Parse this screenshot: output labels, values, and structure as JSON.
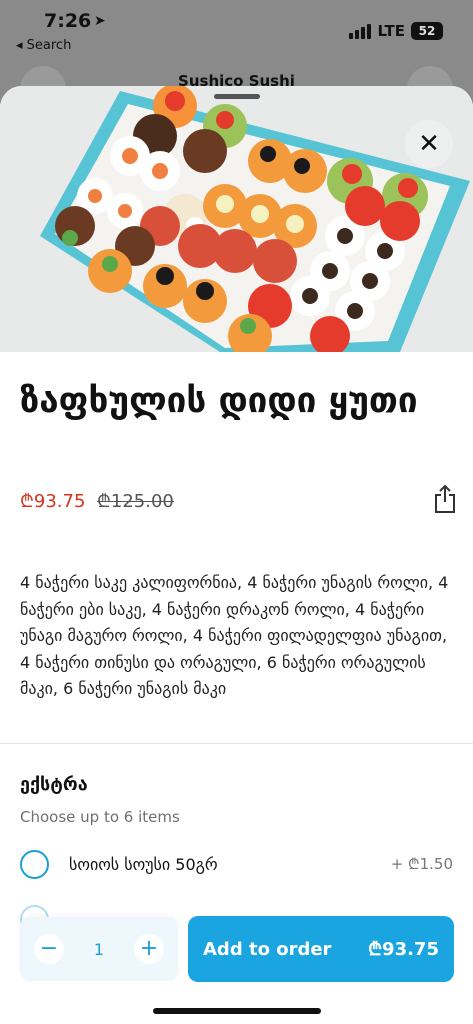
{
  "status_bar": {
    "time": "7:26",
    "back_label": "◂ Search",
    "network": "LTE",
    "battery": "52"
  },
  "background_page": {
    "title": "Sushico Sushi"
  },
  "hero": {
    "image_icon": "sushi-box-photo"
  },
  "product": {
    "title": "ზაფხულის დიდი ყუთი",
    "price_current": "₾93.75",
    "price_old": "₾125.00",
    "description": "4 ნაჭერი საკე კალიფორნია, 4 ნაჭერი უნაგის როლი, 4 ნაჭერი ები საკე, 4 ნაჭერი დრაკონ როლი, 4 ნაჭერი უნაგი მაგურო როლი, 4 ნაჭერი ფილადელფია უნაგით, 4 ნაჭერი თინუსი და ორაგული, 6 ნაჭერი ორაგულის მაკი, 6 ნაჭერი უნაგის მაკი"
  },
  "extras": {
    "title": "ექსტრა",
    "subtitle": "Choose up to 6 items",
    "options": [
      {
        "label": "სოიოს სოუსი 50გრ",
        "price": "+ ₾1.50"
      }
    ]
  },
  "order": {
    "quantity": "1",
    "minus": "−",
    "plus": "+",
    "add_label": "Add to order",
    "total": "₾93.75"
  },
  "colors": {
    "accent": "#1aa5e0",
    "sale_price": "#d4331f"
  }
}
